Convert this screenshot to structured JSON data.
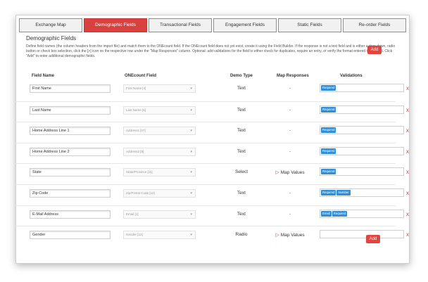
{
  "tabs": [
    {
      "label": "Exchange Map",
      "active": false
    },
    {
      "label": "Demographic Fields",
      "active": true
    },
    {
      "label": "Transactional Fields",
      "active": false
    },
    {
      "label": "Engagement Fields",
      "active": false
    },
    {
      "label": "Static Fields",
      "active": false
    },
    {
      "label": "Re-order Fields",
      "active": false
    }
  ],
  "section": {
    "title": "Demographic Fields",
    "description": "Define field names (the column headers from the import file) and match them to the ONEcount field. If the ONEcount field does not yet exist, create it using the Field Builder. If the response is not a text field and is either a drop down, radio button or check box selection, click the [>] icon on the respective row under the \"Map Responses\" column. Optional: add validations for the field to either check for duplicates, require an entry, or verify the format entered to the field. Click \"Add\" to enter additional demographic fields."
  },
  "add_label": "Add",
  "delete_label": "x",
  "columns": {
    "field_name": "Field Name",
    "onecount_field": "ONEcount Field",
    "demo_type": "Demo Type",
    "map_responses": "Map Responses",
    "validations": "Validations"
  },
  "rows": [
    {
      "field_name": "First Name",
      "onecount_field": "First Name [4]",
      "demo_type": "Text",
      "map": "-",
      "validations": [
        "Required"
      ]
    },
    {
      "field_name": "Last Name",
      "onecount_field": "Last Name [5]",
      "demo_type": "Text",
      "map": "-",
      "validations": [
        "Required"
      ]
    },
    {
      "field_name": "Home Address Line 1",
      "onecount_field": "Address1 [07]",
      "demo_type": "Text",
      "map": "-",
      "validations": [
        "Required"
      ]
    },
    {
      "field_name": "Home Address Line 2",
      "onecount_field": "Address2 [8]",
      "demo_type": "Text",
      "map": "-",
      "validations": [
        "Required"
      ]
    },
    {
      "field_name": "State",
      "onecount_field": "State/Province [11]",
      "demo_type": "Select",
      "map": "Map Values",
      "validations": [
        "Required"
      ]
    },
    {
      "field_name": "Zip Code",
      "onecount_field": "Zip/Postal Code [12]",
      "demo_type": "Text",
      "map": "-",
      "validations": [
        "Required",
        "Number"
      ]
    },
    {
      "field_name": "E-Mail Address",
      "onecount_field": "Email [1]",
      "demo_type": "Text",
      "map": "-",
      "validations": [
        "Email",
        "Required"
      ]
    },
    {
      "field_name": "Gender",
      "onecount_field": "Gender [13]",
      "demo_type": "Radio",
      "map": "Map Values",
      "validations": []
    }
  ],
  "colors": {
    "accent": "#d9413f",
    "badge": "#2f8fd8"
  },
  "icons": {
    "map_values": "triangle-right-icon",
    "dropdown": "chevron-down-icon",
    "delete": "close-icon"
  }
}
